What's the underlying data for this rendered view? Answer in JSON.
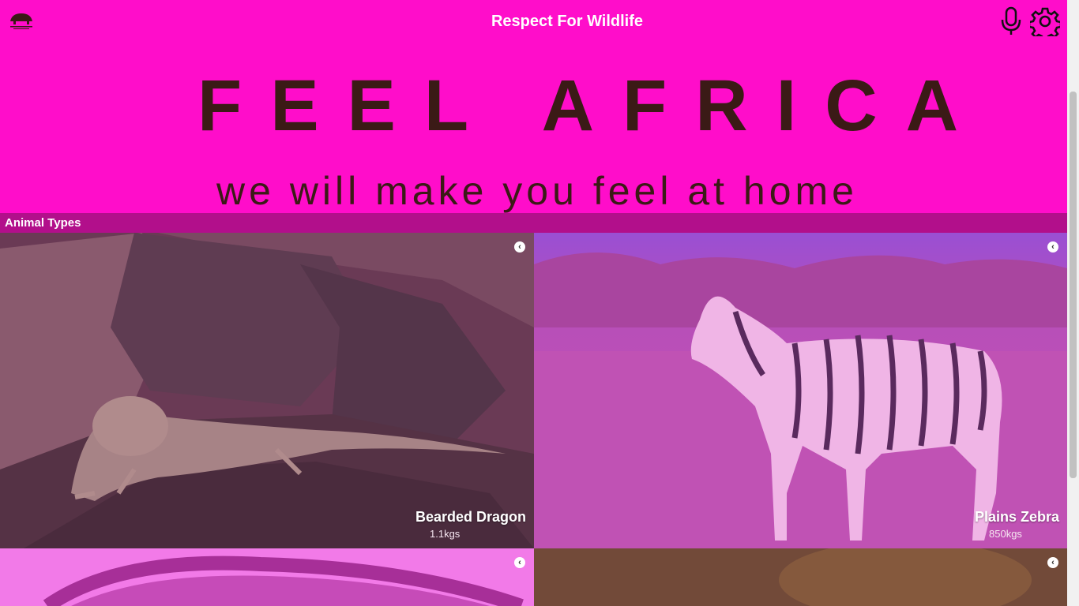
{
  "header": {
    "title": "Respect For Wildlife",
    "logo_icon": "elephant-logo-icon",
    "mic_icon": "microphone-icon",
    "settings_icon": "gear-icon"
  },
  "banner": {
    "title": "FEEL AFRICA",
    "tagline": "we will make you feel at home"
  },
  "section": {
    "title": "Animal Types"
  },
  "animals": [
    {
      "name": "Bearded Dragon",
      "weight": "1.1kgs",
      "info_icon": "chevron-left-circle-icon"
    },
    {
      "name": "Plains Zebra",
      "weight": "850kgs",
      "info_icon": "chevron-left-circle-icon"
    },
    {
      "name": "",
      "weight": "",
      "info_icon": "chevron-left-circle-icon"
    },
    {
      "name": "",
      "weight": "",
      "info_icon": "chevron-left-circle-icon"
    }
  ],
  "colors": {
    "accent": "#ff0dca",
    "section_bar": "#b20f8b",
    "banner_text": "#3b1a16"
  }
}
